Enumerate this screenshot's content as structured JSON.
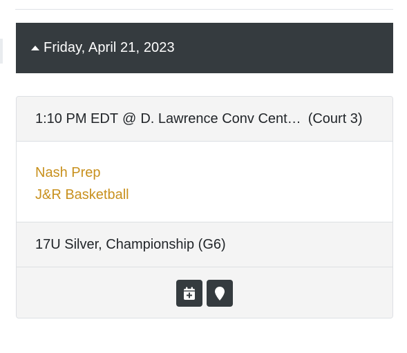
{
  "schedule": {
    "date_header": "Friday, April 21, 2023",
    "game": {
      "time": "1:10 PM EDT",
      "at_symbol": "@",
      "location": "D. Lawrence Conv Cent…",
      "court": "(Court 3)",
      "teams": [
        "Nash Prep",
        "J&R Basketball"
      ],
      "division": "17U Silver, Championship (G6)",
      "actions": [
        {
          "icon": "calendar-plus-icon"
        },
        {
          "icon": "map-marker-icon"
        }
      ]
    }
  },
  "colors": {
    "header_bg": "#353b3f",
    "team_link": "#c8901d",
    "row_bg": "#f4f4f4",
    "border": "#dcdfe3"
  }
}
